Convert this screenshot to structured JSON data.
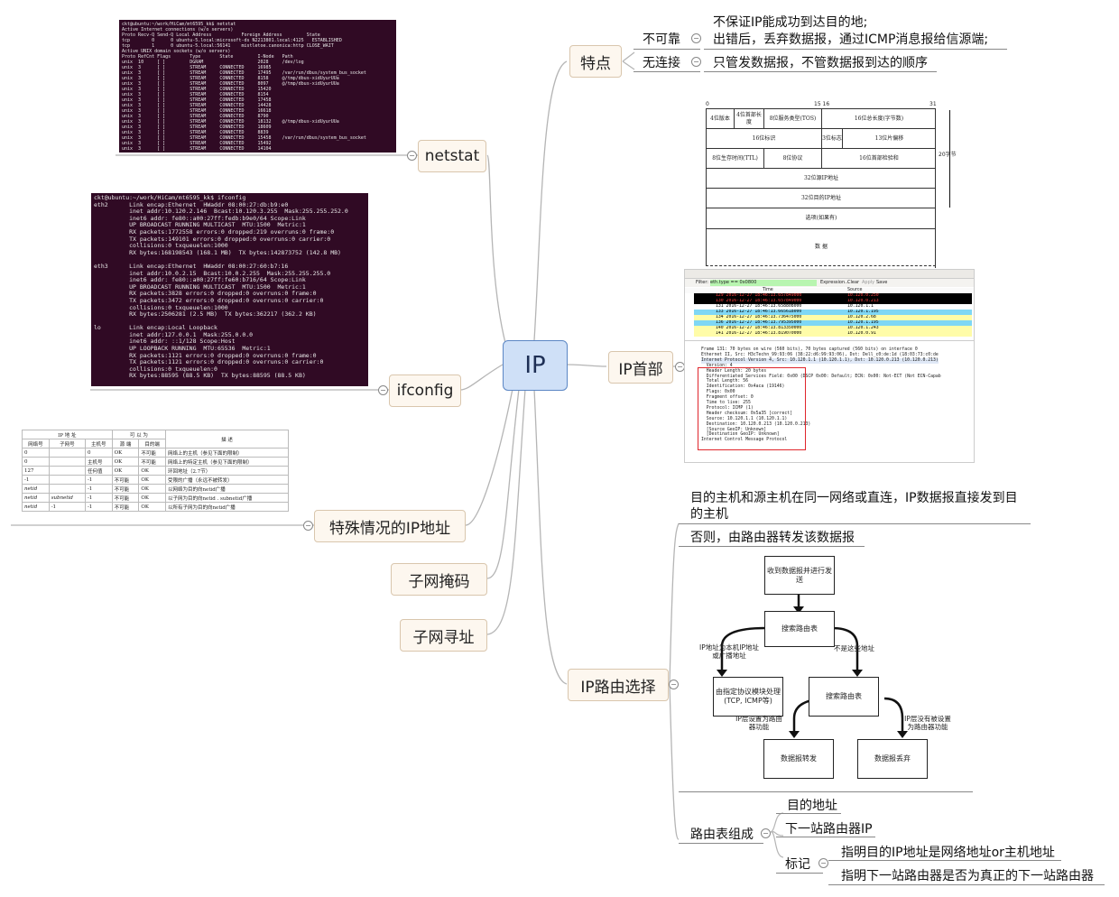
{
  "central": {
    "label": "IP"
  },
  "branches": {
    "features": {
      "label": "特点"
    },
    "header": {
      "label": "IP首部"
    },
    "routing": {
      "label": "IP路由选择"
    },
    "netstat": {
      "label": "netstat"
    },
    "ifconfig": {
      "label": "ifconfig"
    },
    "special": {
      "label": "特殊情况的IP地址"
    },
    "subnet_mask": {
      "label": "子网掩码"
    },
    "subnet_addr": {
      "label": "子网寻址"
    }
  },
  "features": {
    "unreliable": {
      "label": "不可靠",
      "lines": [
        "不保证IP能成功到达目的地;",
        "出错后，丢弃数据报，通过ICMP消息报给信源端;"
      ]
    },
    "connectionless": {
      "label": "无连接",
      "text": "只管发数据报，不管数据报到达的顺序"
    }
  },
  "routing": {
    "direct": [
      "目的主机和源主机在同一网络或直连，IP数据报直接发到目",
      "的主机"
    ],
    "otherwise": "否则，由路由器转发该数据报",
    "table": {
      "label": "路由表组成",
      "dest": "目的地址",
      "next_hop": "下一站路由器IP",
      "flag": {
        "label": "标记",
        "items": [
          "指明目的IP地址是网络地址or主机地址",
          "指明下一站路由器是否为真正的下一站路由器"
        ]
      }
    },
    "flowchart": {
      "recv": "收到数据报并进行发送",
      "search1": "搜索路由表",
      "search2": "搜索路由表",
      "deliver": "由指定协议模块处理(TCP, ICMP等)",
      "forward": "数据报转发",
      "drop": "数据报丢弃",
      "lbl_local": "IP地址为本机IP地址或广播地址",
      "lbl_notaddr": "不是这些地址",
      "lbl_router": "IP层设置为路由器功能",
      "lbl_norouter": "IP层没有被设置为路由器功能"
    }
  },
  "ip_header": {
    "bits": [
      "0",
      "15 16",
      "31"
    ],
    "side_label": "20字节",
    "rows": [
      [
        "4位版本",
        "4位首部长度",
        "8位服务类型(TOS)",
        "16位总长度(字节数)"
      ],
      [
        "16位标识",
        "3位标志",
        "13位片偏移"
      ],
      [
        "8位生存时间(TTL)",
        "8位协议",
        "16位首部检验和"
      ],
      [
        "32位源IP地址"
      ],
      [
        "32位目的IP地址"
      ],
      [
        "选项(如果有)"
      ],
      [
        "数 据"
      ]
    ]
  },
  "netstat_output": [
    "ckt@ubuntu:~/work/HiCam/mt6595_kk$ netstat",
    "Active Internet connections (w/o servers)",
    "Proto Recv-Q Send-Q Local Address           Foreign Address         State",
    "tcp        0      0 ubuntu-5.local:microsoft-ds N2213801.local:4125   ESTABLISHED",
    "tcp        1      0 ubuntu-5.local:56141    mistletoe.canonica:http CLOSE_WAIT",
    "Active UNIX domain sockets (w/o servers)",
    "Proto RefCnt Flags       Type       State         I-Node   Path",
    "unix  10     [ ]         DGRAM                    2028     /dev/log",
    "unix  3      [ ]         STREAM     CONNECTED     16985",
    "unix  3      [ ]         STREAM     CONNECTED     17495    /var/run/dbus/system_bus_socket",
    "unix  3      [ ]         STREAM     CONNECTED     8158     @/tmp/dbus-xidUyurUUa",
    "unix  3      [ ]         STREAM     CONNECTED     8097     @/tmp/dbus-xidUyurUUa",
    "unix  3      [ ]         STREAM     CONNECTED     15420",
    "unix  3      [ ]         STREAM     CONNECTED     8154",
    "unix  3      [ ]         STREAM     CONNECTED     17458",
    "unix  3      [ ]         STREAM     CONNECTED     14428",
    "unix  3      [ ]         STREAM     CONNECTED     16618",
    "unix  3      [ ]         STREAM     CONNECTED     8790",
    "unix  3      [ ]         STREAM     CONNECTED     18132    @/tmp/dbus-xidUyurUUa",
    "unix  3      [ ]         STREAM     CONNECTED     18609",
    "unix  3      [ ]         STREAM     CONNECTED     8839",
    "unix  3      [ ]         STREAM     CONNECTED     15458    /var/run/dbus/system_bus_socket",
    "unix  3      [ ]         STREAM     CONNECTED     15492",
    "unix  3      [ ]         STREAM     CONNECTED     14104"
  ],
  "ifconfig_output": [
    "ckt@ubuntu:~/work/HiCam/mt6595_kk$ ifconfig",
    "eth2      Link encap:Ethernet  HWaddr 08:00:27:db:b9:e0",
    "          inet addr:10.120.2.146  Bcast:10.120.3.255  Mask:255.255.252.0",
    "          inet6 addr: fe80::a00:27ff:fedb:b9e0/64 Scope:Link",
    "          UP BROADCAST RUNNING MULTICAST  MTU:1500  Metric:1",
    "          RX packets:1772558 errors:0 dropped:219 overruns:0 frame:0",
    "          TX packets:149101 errors:0 dropped:0 overruns:0 carrier:0",
    "          collisions:0 txqueuelen:1000",
    "          RX bytes:168198543 (168.1 MB)  TX bytes:142873752 (142.8 MB)",
    "",
    "eth3      Link encap:Ethernet  HWaddr 08:00:27:60:b7:16",
    "          inet addr:10.0.2.15  Bcast:10.0.2.255  Mask:255.255.255.0",
    "          inet6 addr: fe80::a00:27ff:fe60:b716/64 Scope:Link",
    "          UP BROADCAST RUNNING MULTICAST  MTU:1500  Metric:1",
    "          RX packets:3828 errors:0 dropped:0 overruns:0 frame:0",
    "          TX packets:3472 errors:0 dropped:0 overruns:0 carrier:0",
    "          collisions:0 txqueuelen:1000",
    "          RX bytes:2506281 (2.5 MB)  TX bytes:362217 (362.2 KB)",
    "",
    "lo        Link encap:Local Loopback",
    "          inet addr:127.0.0.1  Mask:255.0.0.0",
    "          inet6 addr: ::1/128 Scope:Host",
    "          UP LOOPBACK RUNNING  MTU:65536  Metric:1",
    "          RX packets:1121 errors:0 dropped:0 overruns:0 frame:0",
    "          TX packets:1121 errors:0 dropped:0 overruns:0 carrier:0",
    "          collisions:0 txqueuelen:0",
    "          RX bytes:88595 (88.5 KB)  TX bytes:88595 (88.5 KB)"
  ],
  "special_table": {
    "group_headers": [
      "IP 地 址",
      "可 以 为",
      "描 述"
    ],
    "headers": [
      "网络号",
      "子网号",
      "主机号",
      "源 端",
      "目的端"
    ],
    "rows": [
      [
        "0",
        "",
        "0",
        "OK",
        "不可能",
        "网络上的主机（参见下面的限制）"
      ],
      [
        "0",
        "",
        "主机号",
        "OK",
        "不可能",
        "网络上的特定主机（参见下面的限制）"
      ],
      [
        "127",
        "",
        "任何值",
        "OK",
        "OK",
        "环回地址（2.7节）"
      ],
      [
        "-1",
        "",
        "-1",
        "不可能",
        "OK",
        "受限的广播（永远不被转发）"
      ],
      [
        "netid",
        "",
        "-1",
        "不可能",
        "OK",
        "以网络为目的向netid广播"
      ],
      [
        "netid",
        "subnetid",
        "-1",
        "不可能",
        "OK",
        "以子网为目的向netid . subnetid广播"
      ],
      [
        "netid",
        "-1",
        "-1",
        "不可能",
        "OK",
        "以所有子网为目的向netid广播"
      ]
    ]
  },
  "wireshark": {
    "filter_label": "Filter:",
    "filter_value": "eth.type == 0x0800",
    "buttons": [
      "Expression...",
      "Clear",
      "Apply",
      "Save"
    ],
    "col_time": "Time",
    "col_source": "Source",
    "packets": [
      {
        "no": "129",
        "time": "2016-12-27 18:46:13.657849000",
        "src": "10.120.0.250",
        "bg": "#000000",
        "fg": "#ff4444"
      },
      {
        "no": "130",
        "time": "2016-12-27 18:46:13.657849000",
        "src": "10.120.0.213",
        "bg": "#000000",
        "fg": "#ff4444"
      },
      {
        "no": "131",
        "time": "2016-12-27 18:46:13.658808000",
        "src": "10.120.1.1",
        "bg": "#ffffff",
        "fg": "#000000"
      },
      {
        "no": "133",
        "time": "2016-12-27 18:46:13.665618000",
        "src": "10.120.1.195",
        "bg": "#7fd7f5",
        "fg": "#000000"
      },
      {
        "no": "134",
        "time": "2016-12-27 18:46:13.736475000",
        "src": "10.120.2.68",
        "bg": "#fffca8",
        "fg": "#000000"
      },
      {
        "no": "136",
        "time": "2016-12-27 18:46:13.795395000",
        "src": "10.120.1.195",
        "bg": "#7fd7f5",
        "fg": "#000000"
      },
      {
        "no": "140",
        "time": "2016-12-27 18:46:13.813350000",
        "src": "10.120.1.243",
        "bg": "#fffca8",
        "fg": "#000000"
      },
      {
        "no": "141",
        "time": "2016-12-27 18:46:13.819070000",
        "src": "10.120.0.91",
        "bg": "#fffca8",
        "fg": "#000000"
      }
    ],
    "details": [
      "Frame 131: 70 bytes on wire (560 bits), 70 bytes captured (560 bits) on interface 0",
      "Ethernet II, Src: H3cTechn_99:93:06 (38:22:d6:99:93:06), Dst: Dell_c0:de:1d (18:03:73:c0:de",
      "Internet Protocol Version 4, Src: 10.120.1.1 (10.120.1.1), Dst: 10.120.0.213 (10.120.0.213)",
      "  Version: 4",
      "  Header Length: 20 bytes",
      "  Differentiated Services Field: 0x00 (DSCP 0x00: Default; ECN: 0x00: Not-ECT (Not ECN-Capab",
      "  Total Length: 56",
      "  Identification: 0x4aca (19146)",
      "  Flags: 0x00",
      "  Fragment offset: 0",
      "  Time to live: 255",
      "  Protocol: ICMP (1)",
      "  Header checksum: 0x5a35 [correct]",
      "  Source: 10.120.1.1 (10.120.1.1)",
      "  Destination: 10.120.0.213 (10.120.0.213)",
      "  [Source GeoIP: Unknown]",
      "  [Destination GeoIP: Unknown]",
      "Internet Control Message Protocol"
    ]
  },
  "colors": {
    "central_fill": "#cfe0f7",
    "branch_fill": "#fdf7ef",
    "link": "#b9b9b9",
    "terminal_bg": "#300a24",
    "highlight": "#e0262c"
  }
}
